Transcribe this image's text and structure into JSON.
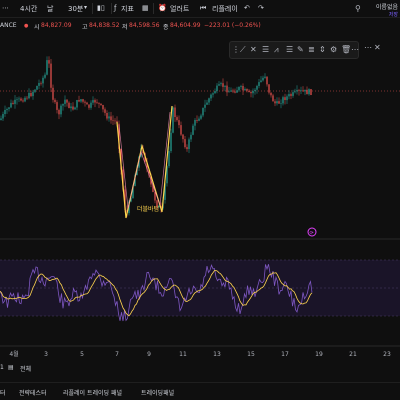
{
  "toolbar": {
    "interval": "4시간",
    "day": "날",
    "minutes": "30분",
    "indicators": "지표",
    "alert": "얼러트",
    "replay": "리플레이"
  },
  "symbol": {
    "exchange": "ANCE",
    "open_label": "시",
    "open": "84,827.09",
    "high_label": "고",
    "high": "84,838.52",
    "low_label": "저",
    "low": "84,598.56",
    "close_label": "종",
    "close": "84,604.99",
    "change": "−223.01 (−0.26%)"
  },
  "colors": {
    "background": "#0f0f0f",
    "up": "#26a69a",
    "down": "#ef5350",
    "pattern": "#ffd54f",
    "pattern2": "#f48fb1",
    "rsi_line": "#7e57c2",
    "rsi_ma": "#ffd54f",
    "accent": "#7b61ff"
  },
  "drawing_tools": [
    "line-icon",
    "cross-icon",
    "fib-icon",
    "pattern-icon",
    "brush-icon",
    "text-icon",
    "measure-icon",
    "zoom-icon",
    "magnet-icon",
    "lock-icon",
    "eye-icon",
    "trash-icon"
  ],
  "right_top": {
    "label": "이름없음",
    "sub": "저장"
  },
  "pattern_label": "더블바텀",
  "x_axis_labels": [
    "4월",
    "3",
    "5",
    "7",
    "9",
    "11",
    "13",
    "15",
    "17",
    "19",
    "21",
    "23"
  ],
  "range_bar": {
    "d1": "1",
    "all": "전체"
  },
  "tabs": [
    "터",
    "전략테스터",
    "리플레이 트레이딩 패널",
    "트레이딩패널"
  ]
}
